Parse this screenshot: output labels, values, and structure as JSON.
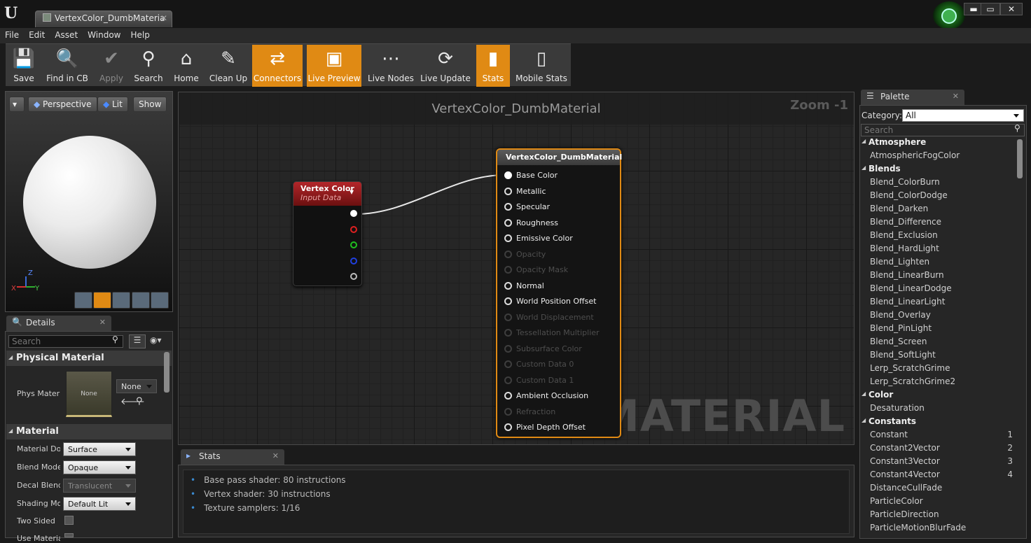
{
  "window": {
    "tab_title": "VertexColor_DumbMateria",
    "btn_min": "▬",
    "btn_max": "▭",
    "btn_close": "✕"
  },
  "menu": [
    "File",
    "Edit",
    "Asset",
    "Window",
    "Help"
  ],
  "toolbar": [
    {
      "label": "Save",
      "icon": "save-icon",
      "state": "normal"
    },
    {
      "label": "Find in CB",
      "icon": "magnifier-icon",
      "state": "normal"
    },
    {
      "label": "Apply",
      "icon": "checkmark-icon",
      "state": "disabled"
    },
    {
      "label": "Search",
      "icon": "binoculars-icon",
      "state": "normal"
    },
    {
      "label": "Home",
      "icon": "home-icon",
      "state": "normal"
    },
    {
      "label": "Clean Up",
      "icon": "broom-icon",
      "state": "normal"
    },
    {
      "label": "Connectors",
      "icon": "connectors-icon",
      "state": "active"
    },
    {
      "label": "Live Preview",
      "icon": "tv-icon",
      "state": "active"
    },
    {
      "label": "Live Nodes",
      "icon": "nodes-icon",
      "state": "normal"
    },
    {
      "label": "Live Update",
      "icon": "refresh-icon",
      "state": "normal"
    },
    {
      "label": "Stats",
      "icon": "bar-stats-icon",
      "state": "active"
    },
    {
      "label": "Mobile Stats",
      "icon": "mobile-stats-icon",
      "state": "normal"
    }
  ],
  "viewport": {
    "perspective": "Perspective",
    "lit": "Lit",
    "show": "Show",
    "axis_x": "X",
    "axis_y": "Y",
    "axis_z": "Z"
  },
  "details": {
    "tab": "Details",
    "search_placeholder": "Search",
    "section_physical": "Physical Material",
    "phys_label": "Phys Materi",
    "phys_thumb": "None",
    "phys_value": "None",
    "section_material": "Material",
    "props": [
      {
        "label": "Material Dor",
        "value": "Surface",
        "enabled": true
      },
      {
        "label": "Blend Mode",
        "value": "Opaque",
        "enabled": true
      },
      {
        "label": "Decal Blend",
        "value": "Translucent",
        "enabled": false
      },
      {
        "label": "Shading Mo",
        "value": "Default Lit",
        "enabled": true
      }
    ],
    "two_sided": "Two Sided",
    "use_material": "Use Materia"
  },
  "graph": {
    "title": "VertexColor_DumbMaterial",
    "zoom": "Zoom -1",
    "watermark": "MATERIAL",
    "vc_node": {
      "title": "Vertex Color",
      "subtitle": "Input Data"
    },
    "mat_node": {
      "title": "VertexColor_DumbMaterial",
      "pins": [
        {
          "label": "Base Color",
          "active": true,
          "connected": true
        },
        {
          "label": "Metallic",
          "active": true,
          "connected": false
        },
        {
          "label": "Specular",
          "active": true,
          "connected": false
        },
        {
          "label": "Roughness",
          "active": true,
          "connected": false
        },
        {
          "label": "Emissive Color",
          "active": true,
          "connected": false
        },
        {
          "label": "Opacity",
          "active": false,
          "connected": false
        },
        {
          "label": "Opacity Mask",
          "active": false,
          "connected": false
        },
        {
          "label": "Normal",
          "active": true,
          "connected": false
        },
        {
          "label": "World Position Offset",
          "active": true,
          "connected": false
        },
        {
          "label": "World Displacement",
          "active": false,
          "connected": false
        },
        {
          "label": "Tessellation Multiplier",
          "active": false,
          "connected": false
        },
        {
          "label": "Subsurface Color",
          "active": false,
          "connected": false
        },
        {
          "label": "Custom Data 0",
          "active": false,
          "connected": false
        },
        {
          "label": "Custom Data 1",
          "active": false,
          "connected": false
        },
        {
          "label": "Ambient Occlusion",
          "active": true,
          "connected": false
        },
        {
          "label": "Refraction",
          "active": false,
          "connected": false
        },
        {
          "label": "Pixel Depth Offset",
          "active": true,
          "connected": false
        }
      ]
    }
  },
  "stats": {
    "tab": "Stats",
    "lines": [
      "Base pass shader: 80 instructions",
      "Vertex shader: 30 instructions",
      "Texture samplers: 1/16"
    ]
  },
  "palette": {
    "tab": "Palette",
    "category_label": "Category:",
    "category_value": "All",
    "search_placeholder": "Search",
    "items": [
      {
        "type": "h",
        "label": "Atmosphere"
      },
      {
        "type": "i",
        "label": "AtmosphericFogColor"
      },
      {
        "type": "h",
        "label": "Blends"
      },
      {
        "type": "i",
        "label": "Blend_ColorBurn"
      },
      {
        "type": "i",
        "label": "Blend_ColorDodge"
      },
      {
        "type": "i",
        "label": "Blend_Darken"
      },
      {
        "type": "i",
        "label": "Blend_Difference"
      },
      {
        "type": "i",
        "label": "Blend_Exclusion"
      },
      {
        "type": "i",
        "label": "Blend_HardLight"
      },
      {
        "type": "i",
        "label": "Blend_Lighten"
      },
      {
        "type": "i",
        "label": "Blend_LinearBurn"
      },
      {
        "type": "i",
        "label": "Blend_LinearDodge"
      },
      {
        "type": "i",
        "label": "Blend_LinearLight"
      },
      {
        "type": "i",
        "label": "Blend_Overlay"
      },
      {
        "type": "i",
        "label": "Blend_PinLight"
      },
      {
        "type": "i",
        "label": "Blend_Screen"
      },
      {
        "type": "i",
        "label": "Blend_SoftLight"
      },
      {
        "type": "i",
        "label": "Lerp_ScratchGrime"
      },
      {
        "type": "i",
        "label": "Lerp_ScratchGrime2"
      },
      {
        "type": "h",
        "label": "Color"
      },
      {
        "type": "i",
        "label": "Desaturation"
      },
      {
        "type": "h",
        "label": "Constants"
      },
      {
        "type": "i",
        "label": "Constant",
        "key": "1"
      },
      {
        "type": "i",
        "label": "Constant2Vector",
        "key": "2"
      },
      {
        "type": "i",
        "label": "Constant3Vector",
        "key": "3"
      },
      {
        "type": "i",
        "label": "Constant4Vector",
        "key": "4"
      },
      {
        "type": "i",
        "label": "DistanceCullFade"
      },
      {
        "type": "i",
        "label": "ParticleColor"
      },
      {
        "type": "i",
        "label": "ParticleDirection"
      },
      {
        "type": "i",
        "label": "ParticleMotionBlurFade"
      }
    ]
  },
  "colors": {
    "accent": "#e08a14",
    "vc_header": "#b3262a",
    "pin_r": "#e02020",
    "pin_g": "#20c020",
    "pin_b": "#2040e0"
  }
}
